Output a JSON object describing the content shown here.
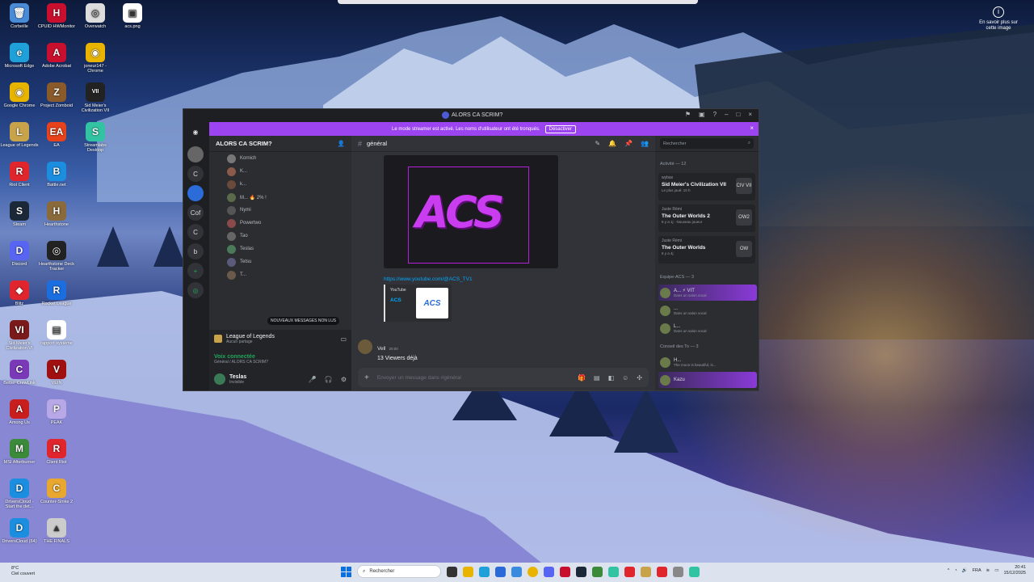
{
  "wallpaper": {
    "info_label": "En savoir plus sur cette image"
  },
  "desktop_icons": [
    {
      "label": "Corbeille",
      "color": "#4a8bd8",
      "glyph": "🗑"
    },
    {
      "label": "CPUID HWMonitor",
      "color": "#c8102e",
      "glyph": "H"
    },
    {
      "label": "Overwatch",
      "color": "#dddddd",
      "glyph": "◎"
    },
    {
      "label": "acs.png",
      "color": "#ffffff",
      "glyph": "▣"
    },
    {
      "label": "Microsoft Edge",
      "color": "#1fa0d8",
      "glyph": "e"
    },
    {
      "label": "Adobe Acrobat",
      "color": "#c8102e",
      "glyph": "A"
    },
    {
      "label": "joneur147 - Chrome",
      "color": "#e8b400",
      "glyph": "◉"
    },
    {
      "label": "Google Chrome",
      "color": "#e8b400",
      "glyph": "◉"
    },
    {
      "label": "Project Zomboid",
      "color": "#8a5a2a",
      "glyph": "Z"
    },
    {
      "label": "Sid Meier's Civilization VII",
      "color": "#222222",
      "glyph": "VII"
    },
    {
      "label": "League of Legends",
      "color": "#c9a34a",
      "glyph": "L"
    },
    {
      "label": "EA",
      "color": "#e8421a",
      "glyph": "EA"
    },
    {
      "label": "Streamlabs Desktop",
      "color": "#31c3a2",
      "glyph": "S"
    },
    {
      "label": "Riot Client",
      "color": "#e0262c",
      "glyph": "R"
    },
    {
      "label": "Battle.net",
      "color": "#1b8ee0",
      "glyph": "B"
    },
    {
      "label": "Steam",
      "color": "#1b2838",
      "glyph": "S"
    },
    {
      "label": "Hearthstone",
      "color": "#8a6a3a",
      "glyph": "H"
    },
    {
      "label": "Discord",
      "color": "#5865f2",
      "glyph": "D"
    },
    {
      "label": "Hearthstone Deck Tracker",
      "color": "#222222",
      "glyph": "◎"
    },
    {
      "label": "Blitz",
      "color": "#e0262c",
      "glyph": "◆"
    },
    {
      "label": "Rocket League",
      "color": "#1b6ee0",
      "glyph": "R"
    },
    {
      "label": "Sid Meier's Civilization VI",
      "color": "#7a1a1a",
      "glyph": "VI"
    },
    {
      "label": "rapport système",
      "color": "#ffffff",
      "glyph": "▤"
    },
    {
      "label": "Better-CrewLink",
      "color": "#7a3ab8",
      "glyph": "C"
    },
    {
      "label": "VEIN",
      "color": "#a01010",
      "glyph": "V"
    },
    {
      "label": "Among Us",
      "color": "#c81e1e",
      "glyph": "A"
    },
    {
      "label": "PEAK",
      "color": "#b8a8e8",
      "glyph": "P"
    },
    {
      "label": "MSI Afterburner",
      "color": "#3a8a3a",
      "glyph": "M"
    },
    {
      "label": "Client Riot",
      "color": "#e0262c",
      "glyph": "R"
    },
    {
      "label": "DriversCloud - Start the det...",
      "color": "#1b8ee0",
      "glyph": "D"
    },
    {
      "label": "Counter-Strike 2",
      "color": "#e8a830",
      "glyph": "C"
    },
    {
      "label": "DriversCloud (64)",
      "color": "#1b8ee0",
      "glyph": "D"
    },
    {
      "label": "THE FINALS",
      "color": "#cccccc",
      "glyph": "▲"
    }
  ],
  "discord": {
    "window_title": "ALORS CA SCRIM?",
    "streamer_banner": "Le mode streamer est activé. Les noms d'utilisateur ont été tronqués.",
    "streamer_button": "Désactiver",
    "guilds": [
      "C",
      "Cof",
      "C",
      "b"
    ],
    "server_name": "ALORS CA SCRIM?",
    "channel_members": [
      "Kornich",
      "K...",
      "k...",
      "M... 🔥 2% !",
      "Nymi",
      "Powertwo",
      "Tao",
      "Teslas",
      "Tetsu",
      "T..."
    ],
    "new_messages": "NOUVEAUX MESSAGES NON LUS",
    "activity": {
      "title": "League of Legends",
      "sub": "Aucun partage"
    },
    "voice": {
      "status": "Voix connectée",
      "channel": "Général / ALORS CA SCRIM?"
    },
    "user": {
      "name": "Teslas",
      "status": "Invisible"
    },
    "channel_name": "général",
    "embed": {
      "logo_text": "ACS",
      "link": "https://www.youtube.com/@ACS_TV1",
      "provider": "YouTube",
      "title": "ACS",
      "thumb_text": "ACS"
    },
    "message": {
      "author": "Vell",
      "time": "20:00",
      "text": "13 Viewers déjà"
    },
    "composer_placeholder": "Envoyer un message dans #général",
    "member_search": "Rechercher",
    "groups": {
      "active": "Activité — 12",
      "team": "Equipe-ACS — 3",
      "council": "Conseil des To — 3"
    },
    "activity_cards": [
      {
        "who": "wybax",
        "game": "Sid Meier's Civilization VII",
        "detail": "Le plus joué: 10 h",
        "icon": "CIV VII"
      },
      {
        "who": "Juste Rémi",
        "game": "The Outer Worlds 2",
        "detail": "6 y a 1j · Nouveau joueur",
        "icon": "OW2"
      },
      {
        "who": "Juste Rémi",
        "game": "The Outer Worlds",
        "detail": "6 y a 4j",
        "icon": "OW"
      }
    ],
    "team_members": [
      {
        "name": "A... ⚡ VIT",
        "status": "Dans un salon vocal"
      },
      {
        "name": "...",
        "status": "Dans un salon vocal"
      },
      {
        "name": "L...",
        "status": "Dans un salon vocal"
      }
    ],
    "council_members": [
      {
        "name": "H...",
        "status": "The moon is beautiful, is..."
      },
      {
        "name": "Kazu",
        "status": ""
      }
    ]
  },
  "taskbar": {
    "weather_temp": "8°C",
    "weather_desc": "Ciel couvert",
    "search_placeholder": "Rechercher",
    "lang": "FRA",
    "time": "20:41",
    "date": "15/12/2025"
  }
}
